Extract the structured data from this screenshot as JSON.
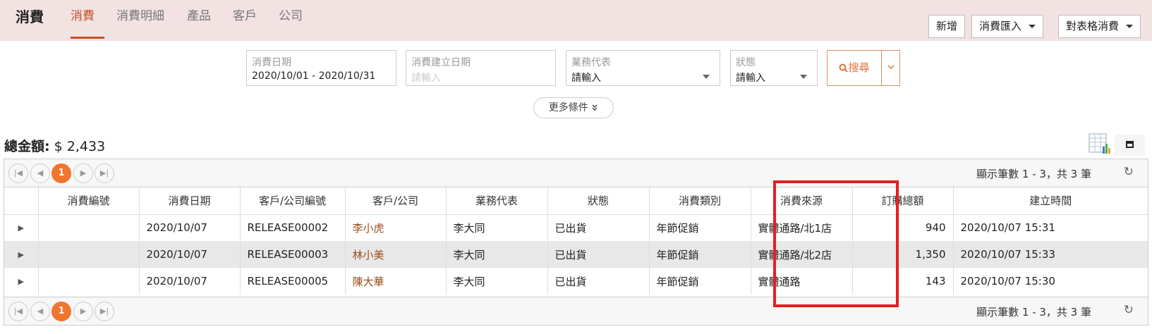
{
  "brand": "消費",
  "nav": [
    "消費",
    "消費明細",
    "產品",
    "客戶",
    "公司"
  ],
  "top_buttons": {
    "add": "新增",
    "import": "消費匯入",
    "export": "對表格消費"
  },
  "filters": {
    "date": {
      "label": "消費日期",
      "value": "2020/10/01 - 2020/10/31"
    },
    "created": {
      "label": "消費建立日期",
      "placeholder": "請輸入"
    },
    "rep": {
      "label": "業務代表",
      "value": "請輸入"
    },
    "status": {
      "label": "狀態",
      "value": "請輸入"
    }
  },
  "search_label": "搜尋",
  "more_label": "更多條件",
  "total": {
    "label": "總金額:",
    "value": "$ 2,433"
  },
  "pager": {
    "current": "1",
    "info": "顯示筆數 1 - 3，共 3 筆"
  },
  "columns": [
    "消費編號",
    "消費日期",
    "客戶/公司編號",
    "客戶/公司",
    "業務代表",
    "狀態",
    "消費類別",
    "消費來源",
    "訂購總額",
    "建立時間"
  ],
  "rows": [
    {
      "id": "",
      "date": "2020/10/07",
      "code": "RELEASE00002",
      "customer": "李小虎",
      "rep": "李大同",
      "status": "已出貨",
      "category": "年節促銷",
      "source": "實體通路/北1店",
      "amount": "940",
      "created": "2020/10/07 15:31"
    },
    {
      "id": "",
      "date": "2020/10/07",
      "code": "RELEASE00003",
      "customer": "林小美",
      "rep": "李大同",
      "status": "已出貨",
      "category": "年節促銷",
      "source": "實體通路/北2店",
      "amount": "1,350",
      "created": "2020/10/07 15:33"
    },
    {
      "id": "",
      "date": "2020/10/07",
      "code": "RELEASE00005",
      "customer": "陳大華",
      "rep": "李大同",
      "status": "已出貨",
      "category": "年節促銷",
      "source": "實體通路",
      "amount": "143",
      "created": "2020/10/07 15:30"
    }
  ],
  "colors": {
    "accent": "#c8512a",
    "highlight": "#e81e1e",
    "pager_current": "#f0752d"
  }
}
